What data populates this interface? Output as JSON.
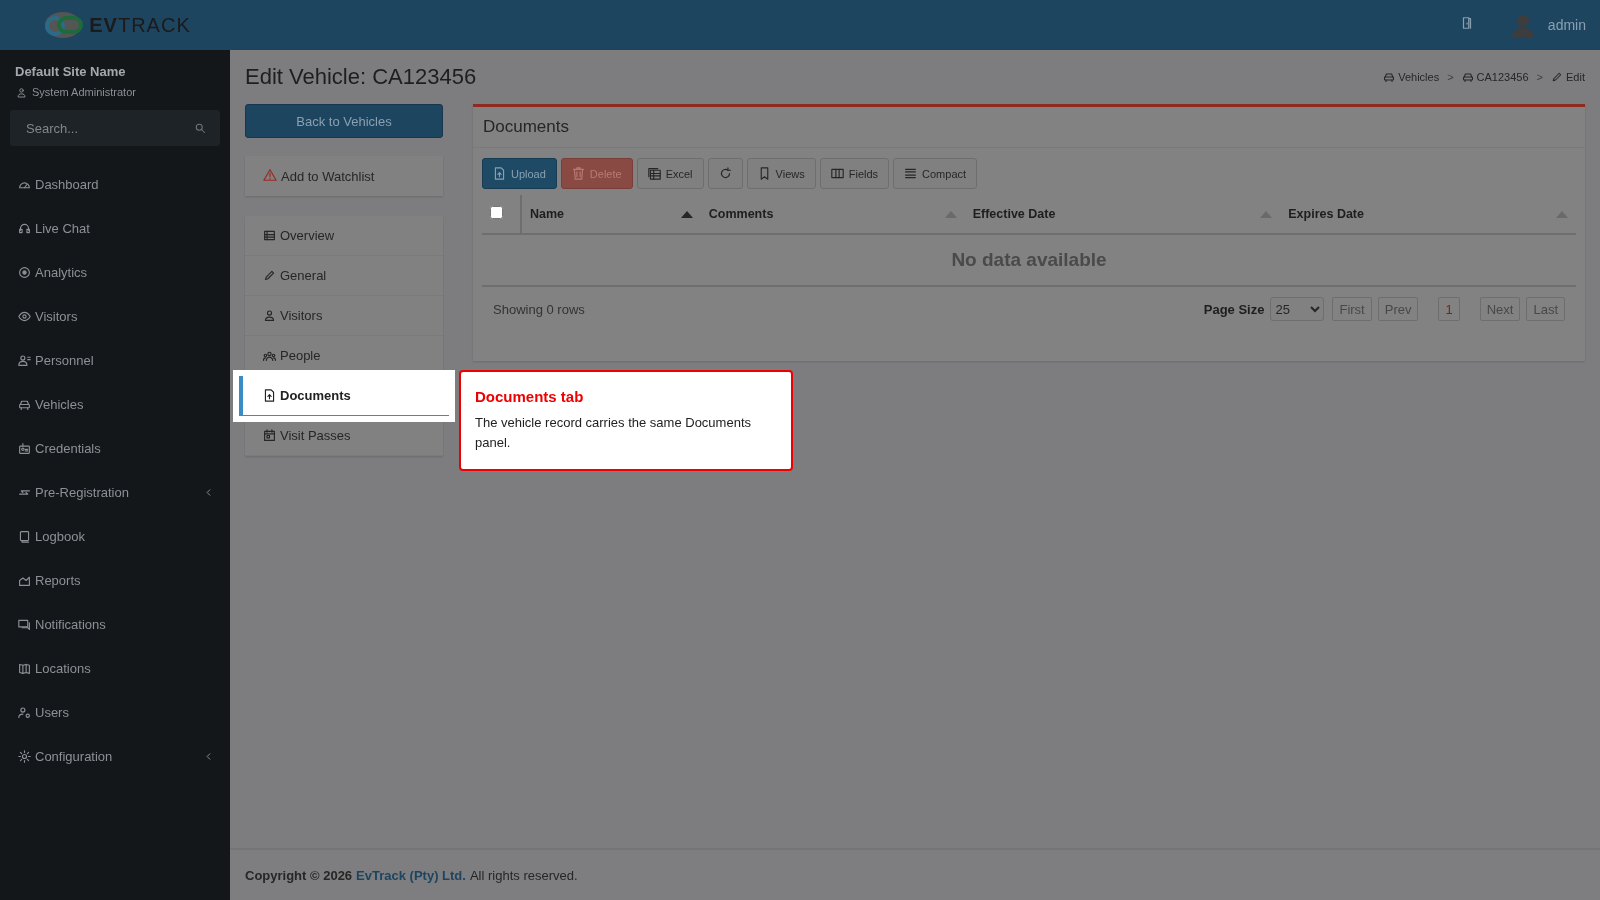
{
  "header": {
    "logo": "**EV**TRACK",
    "user": "admin"
  },
  "sidebar": {
    "site_name": "Default Site Name",
    "role": "System Administrator",
    "search": {
      "placeholder": "Search..."
    },
    "items": [
      {
        "label": "Dashboard",
        "kind": "link"
      },
      {
        "label": "Live Chat",
        "kind": "link"
      },
      {
        "label": "Analytics",
        "kind": "link"
      },
      {
        "label": "Visitors",
        "kind": "link"
      },
      {
        "label": "Personnel",
        "kind": "link"
      },
      {
        "label": "Vehicles",
        "kind": "link"
      },
      {
        "label": "Credentials",
        "kind": "link"
      },
      {
        "label": "Pre-Registration",
        "kind": "submenu"
      },
      {
        "label": "Logbook",
        "kind": "link"
      },
      {
        "label": "Reports",
        "kind": "link"
      },
      {
        "label": "Notifications",
        "kind": "link"
      },
      {
        "label": "Locations",
        "kind": "link"
      },
      {
        "label": "Users",
        "kind": "link"
      },
      {
        "label": "Configuration",
        "kind": "submenu"
      }
    ]
  },
  "page": {
    "title": "Edit Vehicle: CA123456",
    "breadcrumbs": [
      {
        "label": "Vehicles",
        "kind": "car"
      },
      {
        "label": "CA123456",
        "kind": "car",
        "separator": ">"
      },
      {
        "label": "Edit",
        "kind": "pencil",
        "separator": ">"
      }
    ]
  },
  "actions": {
    "back": "Back to Vehicles",
    "watchlist": "Add to Watchlist"
  },
  "tabs": [
    {
      "label": "Overview",
      "selected": false
    },
    {
      "label": "General",
      "selected": false
    },
    {
      "label": "Visitors",
      "selected": false
    },
    {
      "label": "People",
      "selected": false
    },
    {
      "label": "Documents",
      "selected": true
    },
    {
      "label": "Visit Passes",
      "selected": false
    }
  ],
  "panel": {
    "title": "Documents",
    "toolbar": [
      {
        "label": "Upload",
        "kind": "upload",
        "disabled": false
      },
      {
        "label": "Delete",
        "kind": "delete",
        "disabled": true
      },
      {
        "label": "Excel",
        "kind": "excel",
        "disabled": false
      },
      {
        "kind": "refresh",
        "disabled": false
      },
      {
        "label": "Views",
        "kind": "views",
        "disabled": false
      },
      {
        "label": "Fields",
        "kind": "fields",
        "disabled": false
      },
      {
        "label": "Compact",
        "kind": "compact",
        "disabled": false
      }
    ],
    "table": {
      "select_all_checked": false,
      "columns": [
        {
          "label": "Name",
          "sorted": true
        },
        {
          "label": "Comments",
          "sorted": false
        },
        {
          "label": "Effective Date",
          "sorted": false
        },
        {
          "label": "Expires Date",
          "sorted": false
        }
      ],
      "empty_message": "No data available"
    },
    "footer": {
      "summary": "Showing 0 rows",
      "page_size_label": "Page Size",
      "page_size": "25",
      "pager": [
        {
          "label": "First",
          "kind": "nav",
          "disabled": true,
          "selected": false
        },
        {
          "label": "Prev",
          "kind": "nav",
          "disabled": true,
          "selected": false
        },
        {
          "label": "1",
          "kind": "page",
          "disabled": false,
          "selected": true
        },
        {
          "label": "Next",
          "kind": "nav",
          "disabled": true,
          "selected": false
        },
        {
          "label": "Last",
          "kind": "nav",
          "disabled": true,
          "selected": false
        }
      ]
    }
  },
  "callout": {
    "title": "Documents tab",
    "text": "The vehicle record carries the same Documents panel."
  },
  "footer": {
    "copyright": "Copyright © 2026",
    "company": "EvTrack (Pty) Ltd.",
    "rights": "All rights reserved."
  }
}
